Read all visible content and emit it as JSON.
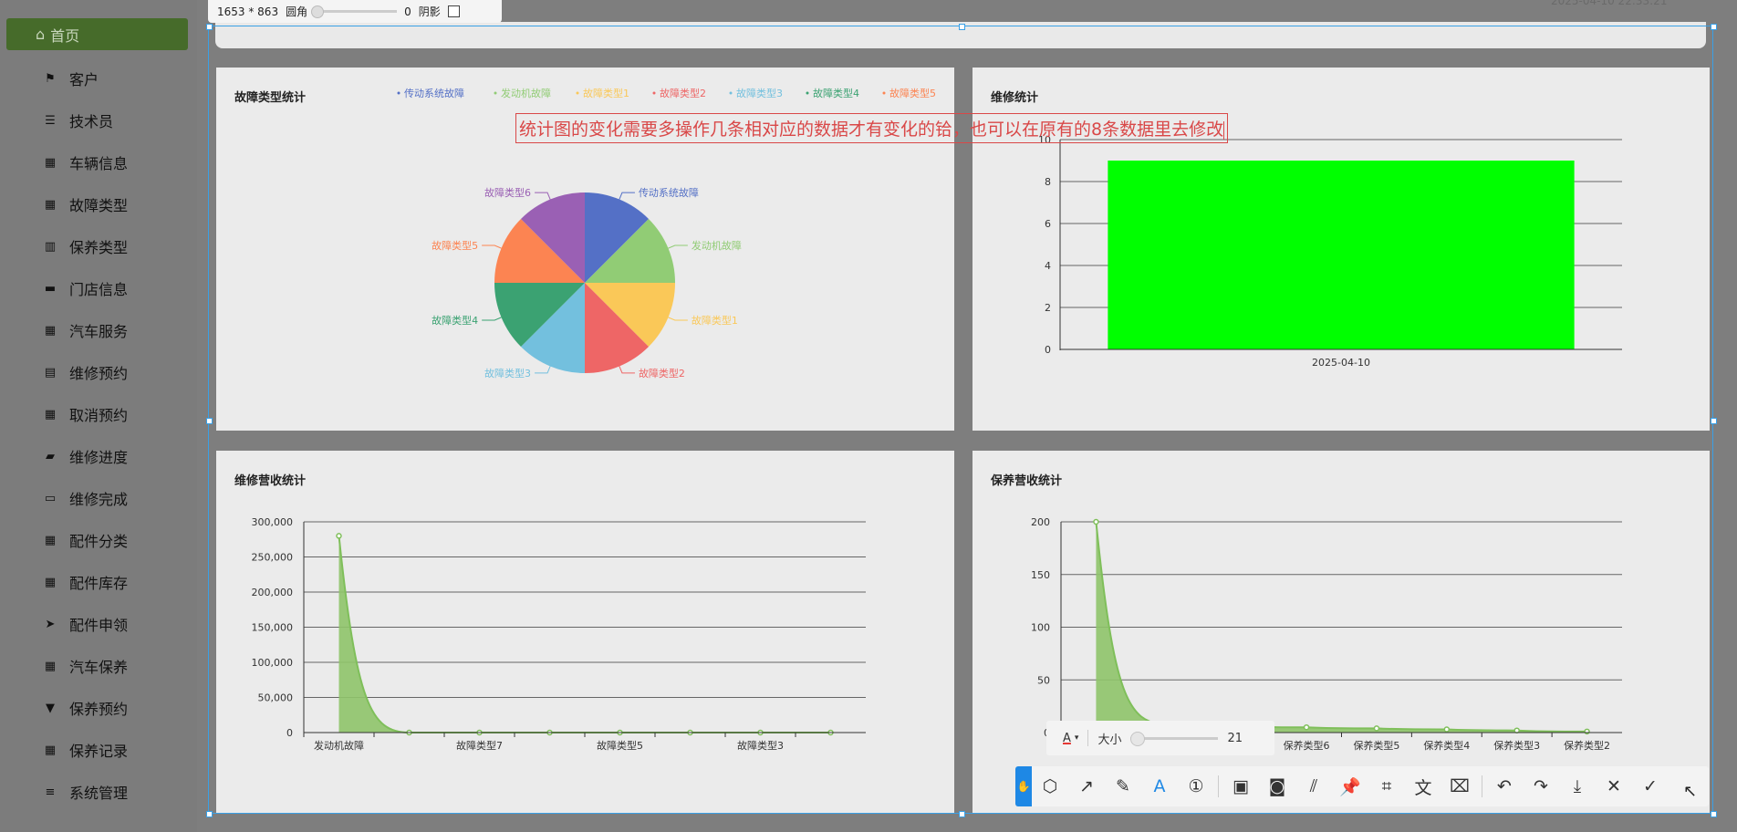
{
  "top_toolbar": {
    "size_text": "1653 * 863",
    "radius_label": "圆角",
    "radius_value": "0",
    "shadow_label": "阴影"
  },
  "date_text": "2025-04-10 22:33:21",
  "sidebar": {
    "home_label": "首页",
    "items": [
      {
        "label": "客户",
        "icon": "flag-icon"
      },
      {
        "label": "技术员",
        "icon": "sliders-icon"
      },
      {
        "label": "车辆信息",
        "icon": "grid-icon"
      },
      {
        "label": "故障类型",
        "icon": "grid-icon"
      },
      {
        "label": "保养类型",
        "icon": "book-icon"
      },
      {
        "label": "门店信息",
        "icon": "ticket-icon"
      },
      {
        "label": "汽车服务",
        "icon": "grid-icon"
      },
      {
        "label": "维修预约",
        "icon": "clipboard-icon"
      },
      {
        "label": "取消预约",
        "icon": "grid-icon"
      },
      {
        "label": "维修进度",
        "icon": "briefcase-icon"
      },
      {
        "label": "维修完成",
        "icon": "printer-icon"
      },
      {
        "label": "配件分类",
        "icon": "grid-icon"
      },
      {
        "label": "配件库存",
        "icon": "grid-icon"
      },
      {
        "label": "配件申领",
        "icon": "send-icon"
      },
      {
        "label": "汽车保养",
        "icon": "apps-icon"
      },
      {
        "label": "保养预约",
        "icon": "trophy-icon"
      },
      {
        "label": "保养记录",
        "icon": "grid-icon"
      },
      {
        "label": "系统管理",
        "icon": "list-icon"
      }
    ]
  },
  "annotation_text": "统计图的变化需要多操作几条相对应的数据才有变化的铪，也可以在原有的8条数据里去修改",
  "colors": {
    "pie": [
      "#5470c6",
      "#91cc75",
      "#fac858",
      "#ee6666",
      "#73c0de",
      "#3ba272",
      "#fc8452",
      "#9a60b4"
    ],
    "bar": "#00ff00",
    "line": "#7fbf5a",
    "area": "#8fc46a",
    "sidebar_active": "#466b2a",
    "selection": "#3aa0e6"
  },
  "cards": {
    "fault": {
      "title": "故障类型统计"
    },
    "repair": {
      "title": "维修统计"
    },
    "repair_revenue": {
      "title": "维修营收统计"
    },
    "maint_revenue": {
      "title": "保养营收统计"
    }
  },
  "sub_toolbar": {
    "size_label": "大小",
    "size_value": "21"
  },
  "bottom_toolbar_icons": [
    "shape-icon",
    "arrow-icon",
    "pen-icon",
    "text-icon",
    "number-icon",
    "mosaic-icon",
    "blur-icon",
    "hatch-icon",
    "pin-icon",
    "ocr-icon",
    "translate-icon",
    "text-detect-icon",
    "undo-icon",
    "redo-icon",
    "download-icon",
    "close-icon",
    "confirm-icon"
  ],
  "chart_data": [
    {
      "type": "pie",
      "legend": [
        "传动系统故障",
        "发动机故障",
        "故障类型1",
        "故障类型2",
        "故障类型3",
        "故障类型4",
        "故障类型5",
        "故障类型6"
      ],
      "labels": [
        "传动系统故障",
        "发动机故障",
        "故障类型1",
        "故障类型2",
        "故障类型3",
        "故障类型4",
        "故障类型5",
        "故障类型6"
      ],
      "values": [
        1,
        1,
        1,
        1,
        1,
        1,
        1,
        1
      ],
      "legend_position": "top-right"
    },
    {
      "type": "bar",
      "categories": [
        "2025-04-10"
      ],
      "values": [
        9
      ],
      "ylim": [
        0,
        10
      ],
      "yticks": [
        0,
        2,
        4,
        6,
        8,
        10
      ]
    },
    {
      "type": "area",
      "categories": [
        "发动机故障",
        "",
        "故障类型7",
        "",
        "故障类型5",
        "",
        "故障类型3",
        ""
      ],
      "values": [
        280000,
        0,
        0,
        0,
        0,
        0,
        0,
        0
      ],
      "ylim": [
        0,
        300000
      ],
      "yticks": [
        "0",
        "50,000",
        "100,000",
        "150,000",
        "200,000",
        "250,000",
        "300,000"
      ]
    },
    {
      "type": "area",
      "categories": [
        "",
        "",
        "",
        "保养类型6",
        "保养类型5",
        "保养类型4",
        "保养类型3",
        "保养类型2"
      ],
      "values": [
        200,
        8,
        6,
        5,
        4,
        3,
        2,
        1
      ],
      "ylim": [
        0,
        200
      ],
      "yticks": [
        "0",
        "50",
        "100",
        "150",
        "200"
      ]
    }
  ]
}
